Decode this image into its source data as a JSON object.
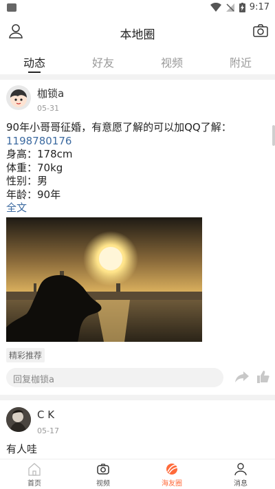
{
  "status": {
    "time": "9:17"
  },
  "header": {
    "title": "本地圈"
  },
  "tabs": [
    {
      "label": "动态"
    },
    {
      "label": "好友"
    },
    {
      "label": "视频"
    },
    {
      "label": "附近"
    }
  ],
  "posts": [
    {
      "name": "枷锁a",
      "date": "05-31",
      "lines": [
        "90年小哥哥征婚，有意愿了解的可以加QQ了解：",
        "1198780176",
        "身高：178cm",
        "体重：70kg",
        "性别：男",
        "年龄：90年"
      ],
      "more": "全文",
      "tag": "精彩推荐",
      "reply_placeholder": "回复枷锁a"
    },
    {
      "name": "C K",
      "date": "05-17",
      "lines": [
        "有人哇"
      ]
    }
  ],
  "nav": [
    {
      "label": "首页"
    },
    {
      "label": "视频"
    },
    {
      "label": "海友圈"
    },
    {
      "label": "消息"
    }
  ],
  "colors": {
    "accent": "#ff6a3a",
    "link": "#3c6aa0"
  }
}
